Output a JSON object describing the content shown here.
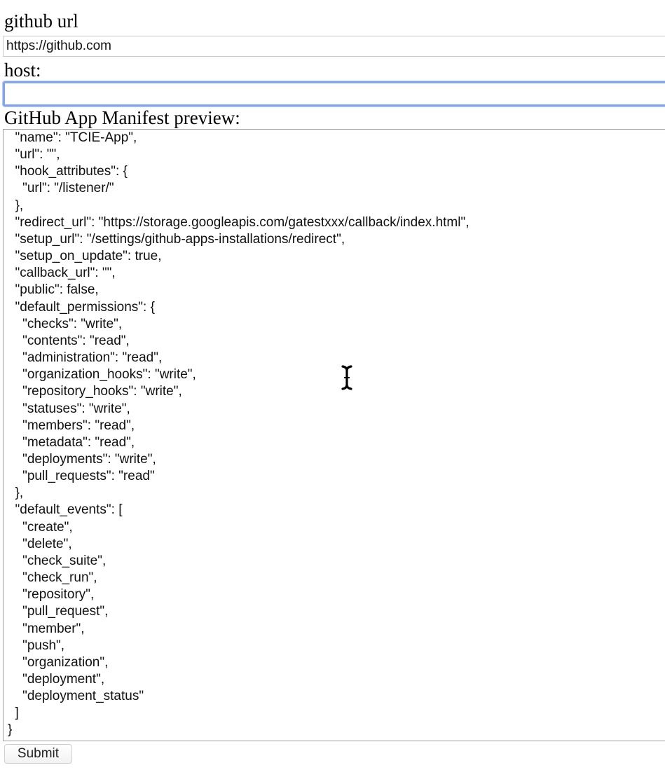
{
  "form": {
    "github_url_label": "github url",
    "github_url_value": "https://github.com",
    "host_label": "host:",
    "host_value": "",
    "manifest_label": "GitHub App Manifest preview:",
    "submit_label": "Submit"
  },
  "manifest": {
    "text": "  \"name\": \"TCIE-App\",\n  \"url\": \"\",\n  \"hook_attributes\": {\n    \"url\": \"/listener/\"\n  },\n  \"redirect_url\": \"https://storage.googleapis.com/gatestxxx/callback/index.html\",\n  \"setup_url\": \"/settings/github-apps-installations/redirect\",\n  \"setup_on_update\": true,\n  \"callback_url\": \"\",\n  \"public\": false,\n  \"default_permissions\": {\n    \"checks\": \"write\",\n    \"contents\": \"read\",\n    \"administration\": \"read\",\n    \"organization_hooks\": \"write\",\n    \"repository_hooks\": \"write\",\n    \"statuses\": \"write\",\n    \"members\": \"read\",\n    \"metadata\": \"read\",\n    \"deployments\": \"write\",\n    \"pull_requests\": \"read\"\n  },\n  \"default_events\": [\n    \"create\",\n    \"delete\",\n    \"check_suite\",\n    \"check_run\",\n    \"repository\",\n    \"pull_request\",\n    \"member\",\n    \"push\",\n    \"organization\",\n    \"deployment\",\n    \"deployment_status\"\n  ]\n}"
  },
  "icons": {
    "cursor": "text-cursor-icon"
  }
}
